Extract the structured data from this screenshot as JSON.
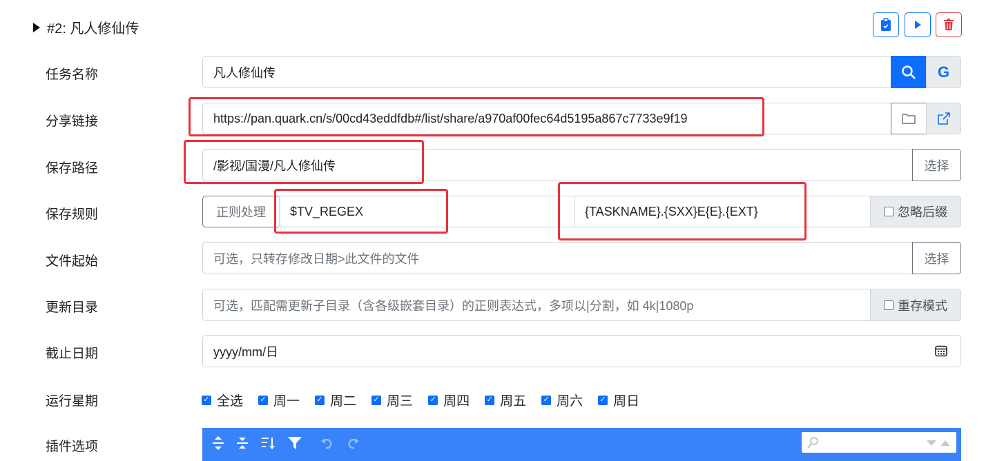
{
  "header": {
    "title": "#2: 凡人修仙传"
  },
  "actions": {
    "copy": "clipboard-icon",
    "run": "play-icon",
    "delete": "trash-icon"
  },
  "labels": {
    "task_name": "任务名称",
    "share_link": "分享链接",
    "save_path": "保存路径",
    "save_rule": "保存规则",
    "file_start": "文件起始",
    "update_dir": "更新目录",
    "end_date": "截止日期",
    "run_week": "运行星期",
    "plugin": "插件选项"
  },
  "fields": {
    "task_name": "凡人修仙传",
    "share_link": "https://pan.quark.cn/s/00cd43eddfdb#/list/share/a970af00fec64d5195a867c7733e9f19",
    "save_path": "/影视/国漫/凡人修仙传",
    "regex_btn": "正则处理",
    "pattern": "$TV_REGEX",
    "replace": "{TASKNAME}.{SXX}E{E}.{EXT}",
    "ignore_ext": "忽略后缀",
    "file_start_placeholder": "可选，只转存修改日期>此文件的文件",
    "choose": "选择",
    "update_dir_placeholder": "可选，匹配需更新子目录（含各级嵌套目录）的正则表达式，多项以|分割，如 4k|1080p",
    "resave_mode": "重存模式",
    "date_placeholder": "yyyy/mm/日"
  },
  "weekdays": [
    "全选",
    "周一",
    "周二",
    "周三",
    "周四",
    "周五",
    "周六",
    "周日"
  ],
  "colors": {
    "primary": "#0d6efd",
    "danger": "#dc3545",
    "highlight": "#e8323c",
    "toolbar": "#3883fa"
  }
}
